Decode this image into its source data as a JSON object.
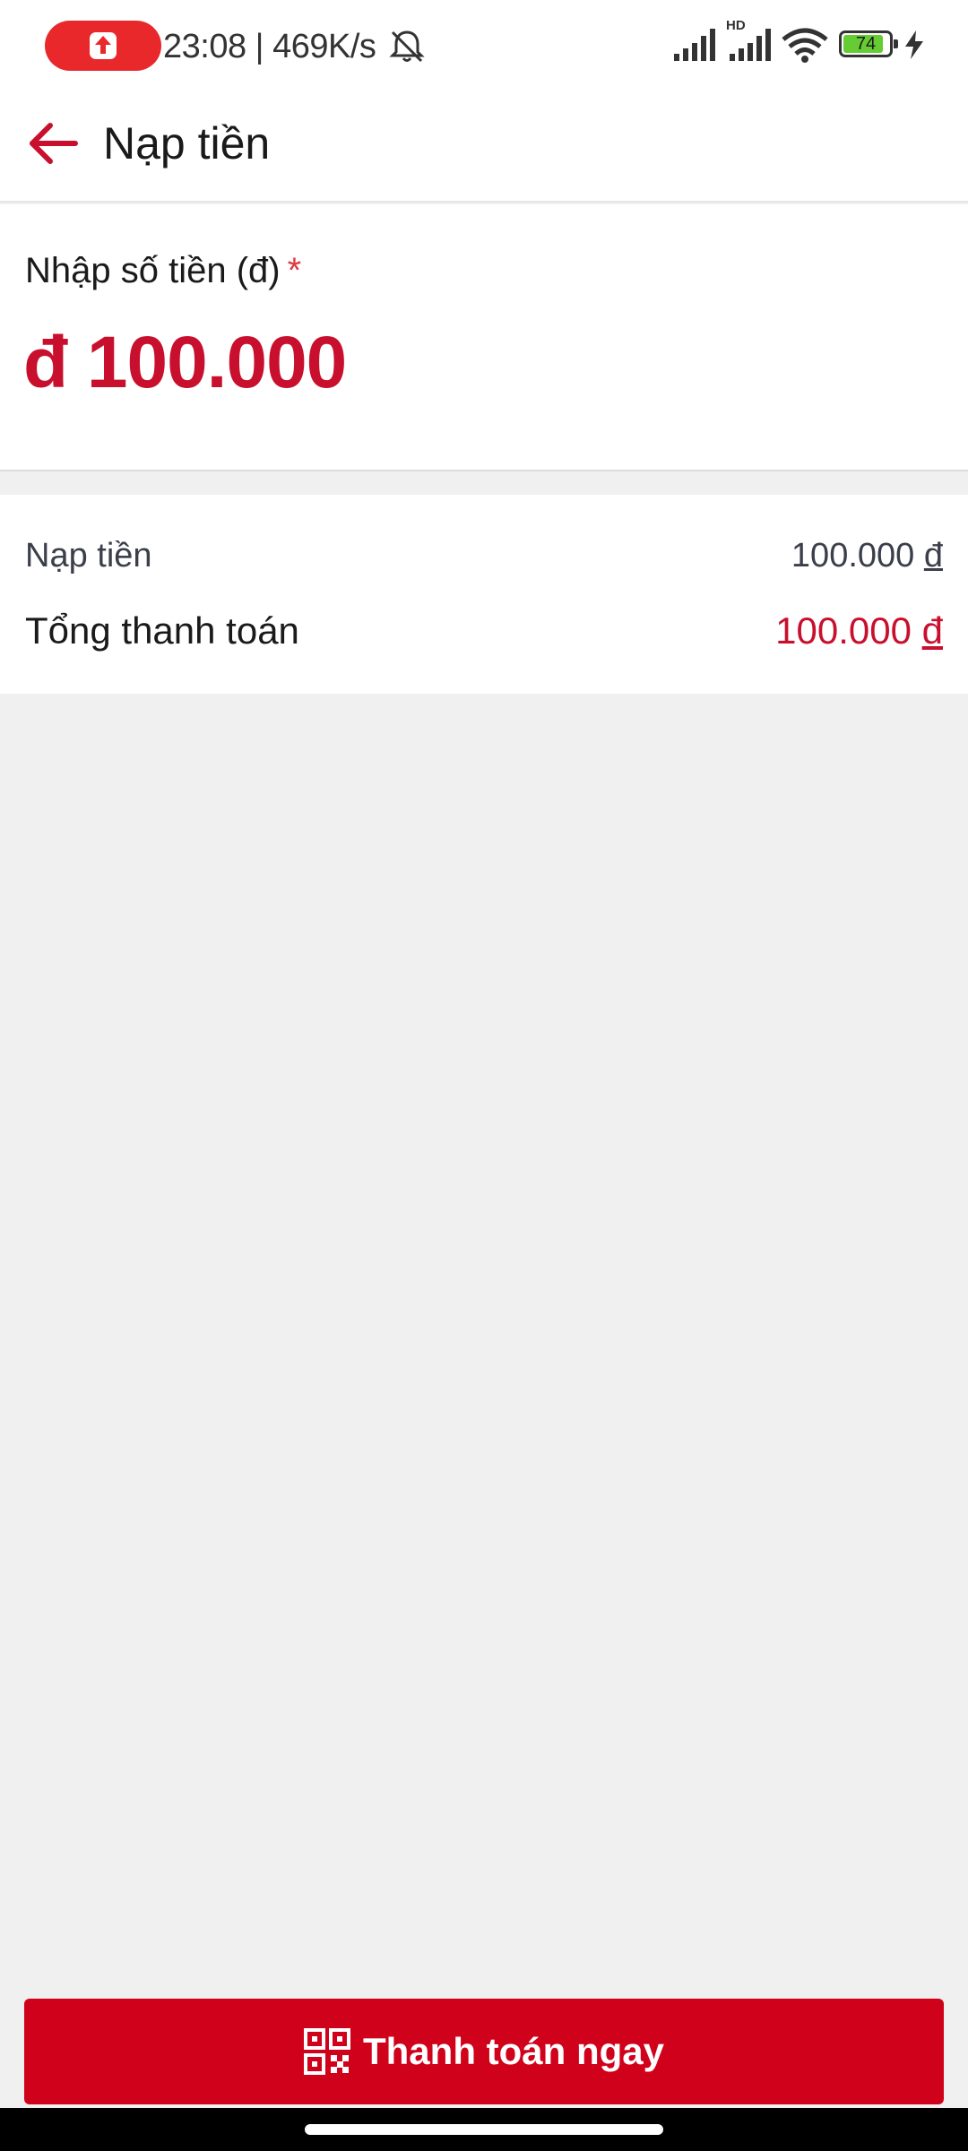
{
  "status_bar": {
    "time_speed": "23:08 | 469K/s",
    "network_label": "HD",
    "battery_level": "74",
    "recording_color": "#e8282b"
  },
  "header": {
    "title": "Nạp tiền",
    "back_icon": "arrow-left-icon"
  },
  "amount": {
    "label": "Nhập số tiền (đ)",
    "required_mark": "*",
    "value": "đ 100.000"
  },
  "summary": {
    "topup_label": "Nạp tiền",
    "topup_amount": "100.000",
    "total_label": "Tổng thanh toán",
    "total_amount": "100.000",
    "currency": "đ"
  },
  "pay_button": {
    "label": "Thanh toán ngay",
    "icon": "qr-code-icon"
  },
  "colors": {
    "accent": "#c8102e",
    "button": "#d0021b",
    "background": "#f0f0f0"
  }
}
